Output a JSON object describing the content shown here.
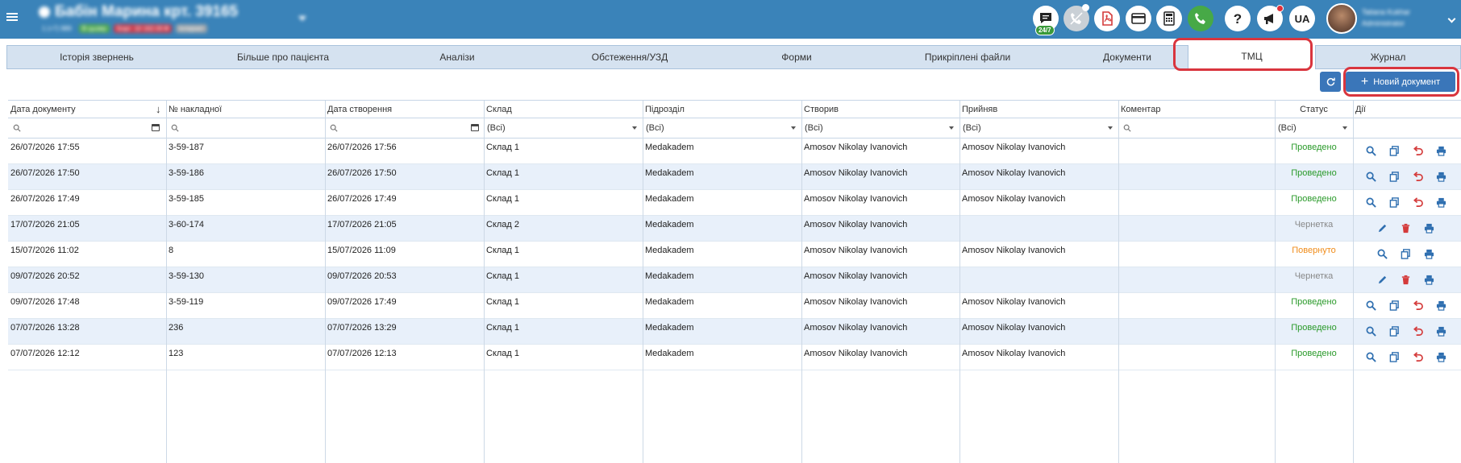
{
  "header": {
    "patient_name": "Бабін Марина крт. 39165",
    "patient_tags": [
      "1 (+7) 989",
      "В цьому",
      "Борг: 10 162.00 ₴",
      "Інтернет"
    ],
    "chat_badge": "24/7",
    "lang": "UA",
    "user_name": "Tatiana Kukhar",
    "user_role": "Administrator",
    "accent": "#3a83b9"
  },
  "tabs": [
    {
      "label": "Історія звернень"
    },
    {
      "label": "Більше про пацієнта"
    },
    {
      "label": "Аналізи"
    },
    {
      "label": "Обстеження/УЗД"
    },
    {
      "label": "Форми"
    },
    {
      "label": "Прикріплені файли"
    },
    {
      "label": "Документи"
    },
    {
      "label": "ТМЦ"
    },
    {
      "label": "Журнал"
    }
  ],
  "toolbar": {
    "new_document_label": "Новий документ"
  },
  "table": {
    "columns": [
      "Дата документу",
      "№ накладної",
      "Дата створення",
      "Склад",
      "Підрозділ",
      "Створив",
      "Прийняв",
      "Коментар",
      "Статус",
      "Дії"
    ],
    "filters": {
      "all_value": "(Всі)"
    },
    "rows": [
      {
        "doc_date": "26/07/2026 17:55",
        "invoice": "3-59-187",
        "created": "26/07/2026 17:56",
        "warehouse": "Склад 1",
        "division": "Medakadem",
        "creator": "Amosov Nikolay Ivanovich",
        "receiver": "Amosov Nikolay Ivanovich",
        "comment": "",
        "status": "Проведено",
        "status_color": "#2a9a2a",
        "actions": "posted"
      },
      {
        "doc_date": "26/07/2026 17:50",
        "invoice": "3-59-186",
        "created": "26/07/2026 17:50",
        "warehouse": "Склад 1",
        "division": "Medakadem",
        "creator": "Amosov Nikolay Ivanovich",
        "receiver": "Amosov Nikolay Ivanovich",
        "comment": "",
        "status": "Проведено",
        "status_color": "#2a9a2a",
        "actions": "posted"
      },
      {
        "doc_date": "26/07/2026 17:49",
        "invoice": "3-59-185",
        "created": "26/07/2026 17:49",
        "warehouse": "Склад 1",
        "division": "Medakadem",
        "creator": "Amosov Nikolay Ivanovich",
        "receiver": "Amosov Nikolay Ivanovich",
        "comment": "",
        "status": "Проведено",
        "status_color": "#2a9a2a",
        "actions": "posted"
      },
      {
        "doc_date": "17/07/2026 21:05",
        "invoice": "3-60-174",
        "created": "17/07/2026 21:05",
        "warehouse": "Склад 2",
        "division": "Medakadem",
        "creator": "Amosov Nikolay Ivanovich",
        "receiver": "",
        "comment": "",
        "status": "Чернетка",
        "status_color": "#888888",
        "actions": "draft"
      },
      {
        "doc_date": "15/07/2026 11:02",
        "invoice": "8",
        "created": "15/07/2026 11:09",
        "warehouse": "Склад 1",
        "division": "Medakadem",
        "creator": "Amosov Nikolay Ivanovich",
        "receiver": "Amosov Nikolay Ivanovich",
        "comment": "",
        "status": "Повернуто",
        "status_color": "#f08c1a",
        "actions": "returned"
      },
      {
        "doc_date": "09/07/2026 20:52",
        "invoice": "3-59-130",
        "created": "09/07/2026 20:53",
        "warehouse": "Склад 1",
        "division": "Medakadem",
        "creator": "Amosov Nikolay Ivanovich",
        "receiver": "",
        "comment": "",
        "status": "Чернетка",
        "status_color": "#888888",
        "actions": "draft"
      },
      {
        "doc_date": "09/07/2026 17:48",
        "invoice": "3-59-119",
        "created": "09/07/2026 17:49",
        "warehouse": "Склад 1",
        "division": "Medakadem",
        "creator": "Amosov Nikolay Ivanovich",
        "receiver": "Amosov Nikolay Ivanovich",
        "comment": "",
        "status": "Проведено",
        "status_color": "#2a9a2a",
        "actions": "posted"
      },
      {
        "doc_date": "07/07/2026 13:28",
        "invoice": "236",
        "created": "07/07/2026 13:29",
        "warehouse": "Склад 1",
        "division": "Medakadem",
        "creator": "Amosov Nikolay Ivanovich",
        "receiver": "Amosov Nikolay Ivanovich",
        "comment": "",
        "status": "Проведено",
        "status_color": "#2a9a2a",
        "actions": "posted"
      },
      {
        "doc_date": "07/07/2026 12:12",
        "invoice": "123",
        "created": "07/07/2026 12:13",
        "warehouse": "Склад 1",
        "division": "Medakadem",
        "creator": "Amosov Nikolay Ivanovich",
        "receiver": "Amosov Nikolay Ivanovich",
        "comment": "",
        "status": "Проведено",
        "status_color": "#2a9a2a",
        "actions": "posted"
      }
    ]
  }
}
